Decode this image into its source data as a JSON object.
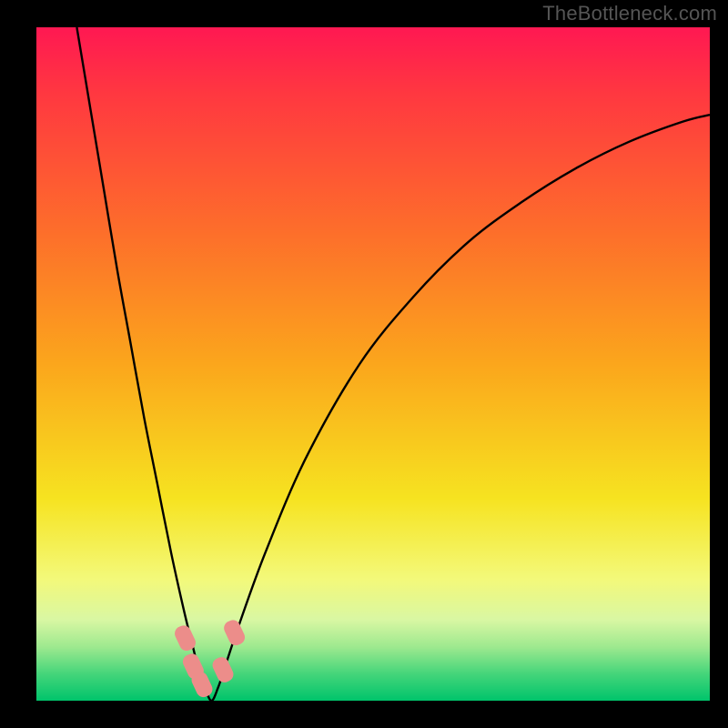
{
  "watermark": "TheBottleneck.com",
  "colors": {
    "frame": "#000000",
    "curve": "#000000",
    "marker": "#ec8d8a",
    "gradient_stops": [
      {
        "offset": 0.0,
        "color": "#ff1852"
      },
      {
        "offset": 0.1,
        "color": "#ff3840"
      },
      {
        "offset": 0.3,
        "color": "#fd6d2b"
      },
      {
        "offset": 0.5,
        "color": "#fba61c"
      },
      {
        "offset": 0.7,
        "color": "#f6e320"
      },
      {
        "offset": 0.82,
        "color": "#f3f97a"
      },
      {
        "offset": 0.88,
        "color": "#d9f7a3"
      },
      {
        "offset": 0.92,
        "color": "#9ee98f"
      },
      {
        "offset": 0.96,
        "color": "#45d57a"
      },
      {
        "offset": 1.0,
        "color": "#00c46b"
      }
    ]
  },
  "chart_data": {
    "type": "line",
    "title": "",
    "xlabel": "",
    "ylabel": "",
    "xlim": [
      0,
      100
    ],
    "ylim": [
      0,
      100
    ],
    "x": [
      6,
      8,
      10,
      12,
      14,
      16,
      18,
      20,
      22,
      23,
      24,
      25,
      26,
      27,
      28,
      30,
      34,
      40,
      48,
      56,
      64,
      72,
      80,
      88,
      96,
      100
    ],
    "values": [
      100,
      88,
      76,
      64,
      53,
      42,
      32,
      22,
      13,
      9,
      5,
      2,
      0,
      2,
      5,
      11,
      22,
      36,
      50,
      60,
      68,
      74,
      79,
      83,
      86,
      87
    ],
    "markers": [
      {
        "x": 22.1,
        "y": 9.3
      },
      {
        "x": 23.3,
        "y": 5.1
      },
      {
        "x": 24.6,
        "y": 2.4
      },
      {
        "x": 27.7,
        "y": 4.6
      },
      {
        "x": 29.4,
        "y": 10.1
      }
    ],
    "minimum_x": 25
  }
}
